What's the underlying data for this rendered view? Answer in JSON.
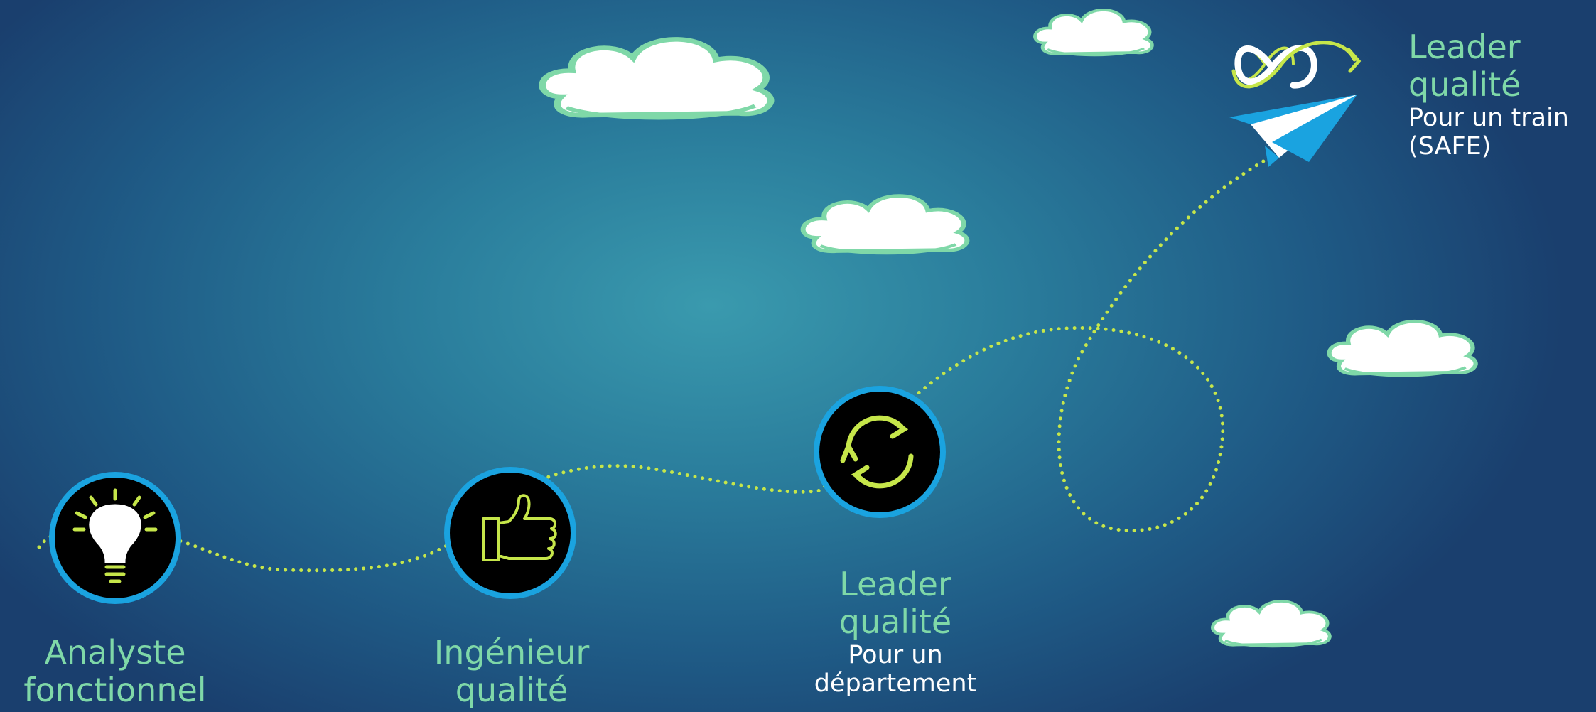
{
  "colors": {
    "path_dots": "#c6e64a",
    "circle_ring": "#1aa3e0",
    "circle_fill": "#000000",
    "icon_stroke": "#c6e64a",
    "role_text": "#7fd8a8",
    "sub_text": "#ffffff",
    "cloud_fill": "#ffffff",
    "cloud_edge": "#7fd8a8"
  },
  "icons": [
    "lightbulb-icon",
    "thumbs-up-icon",
    "refresh-cycle-icon",
    "infinity-arrow-icon",
    "paper-plane-icon",
    "cloud-icon"
  ],
  "steps": [
    {
      "role_line1": "Analyste",
      "role_line2": "fonctionnel",
      "sub_line1": "",
      "sub_line2": ""
    },
    {
      "role_line1": "Ingénieur",
      "role_line2": "qualité",
      "sub_line1": "",
      "sub_line2": ""
    },
    {
      "role_line1": "Leader",
      "role_line2": "qualité",
      "sub_line1": "Pour un",
      "sub_line2": "département"
    },
    {
      "role_line1": "Leader",
      "role_line2": "qualité",
      "sub_line1": "Pour un train",
      "sub_line2": "(SAFE)"
    }
  ]
}
